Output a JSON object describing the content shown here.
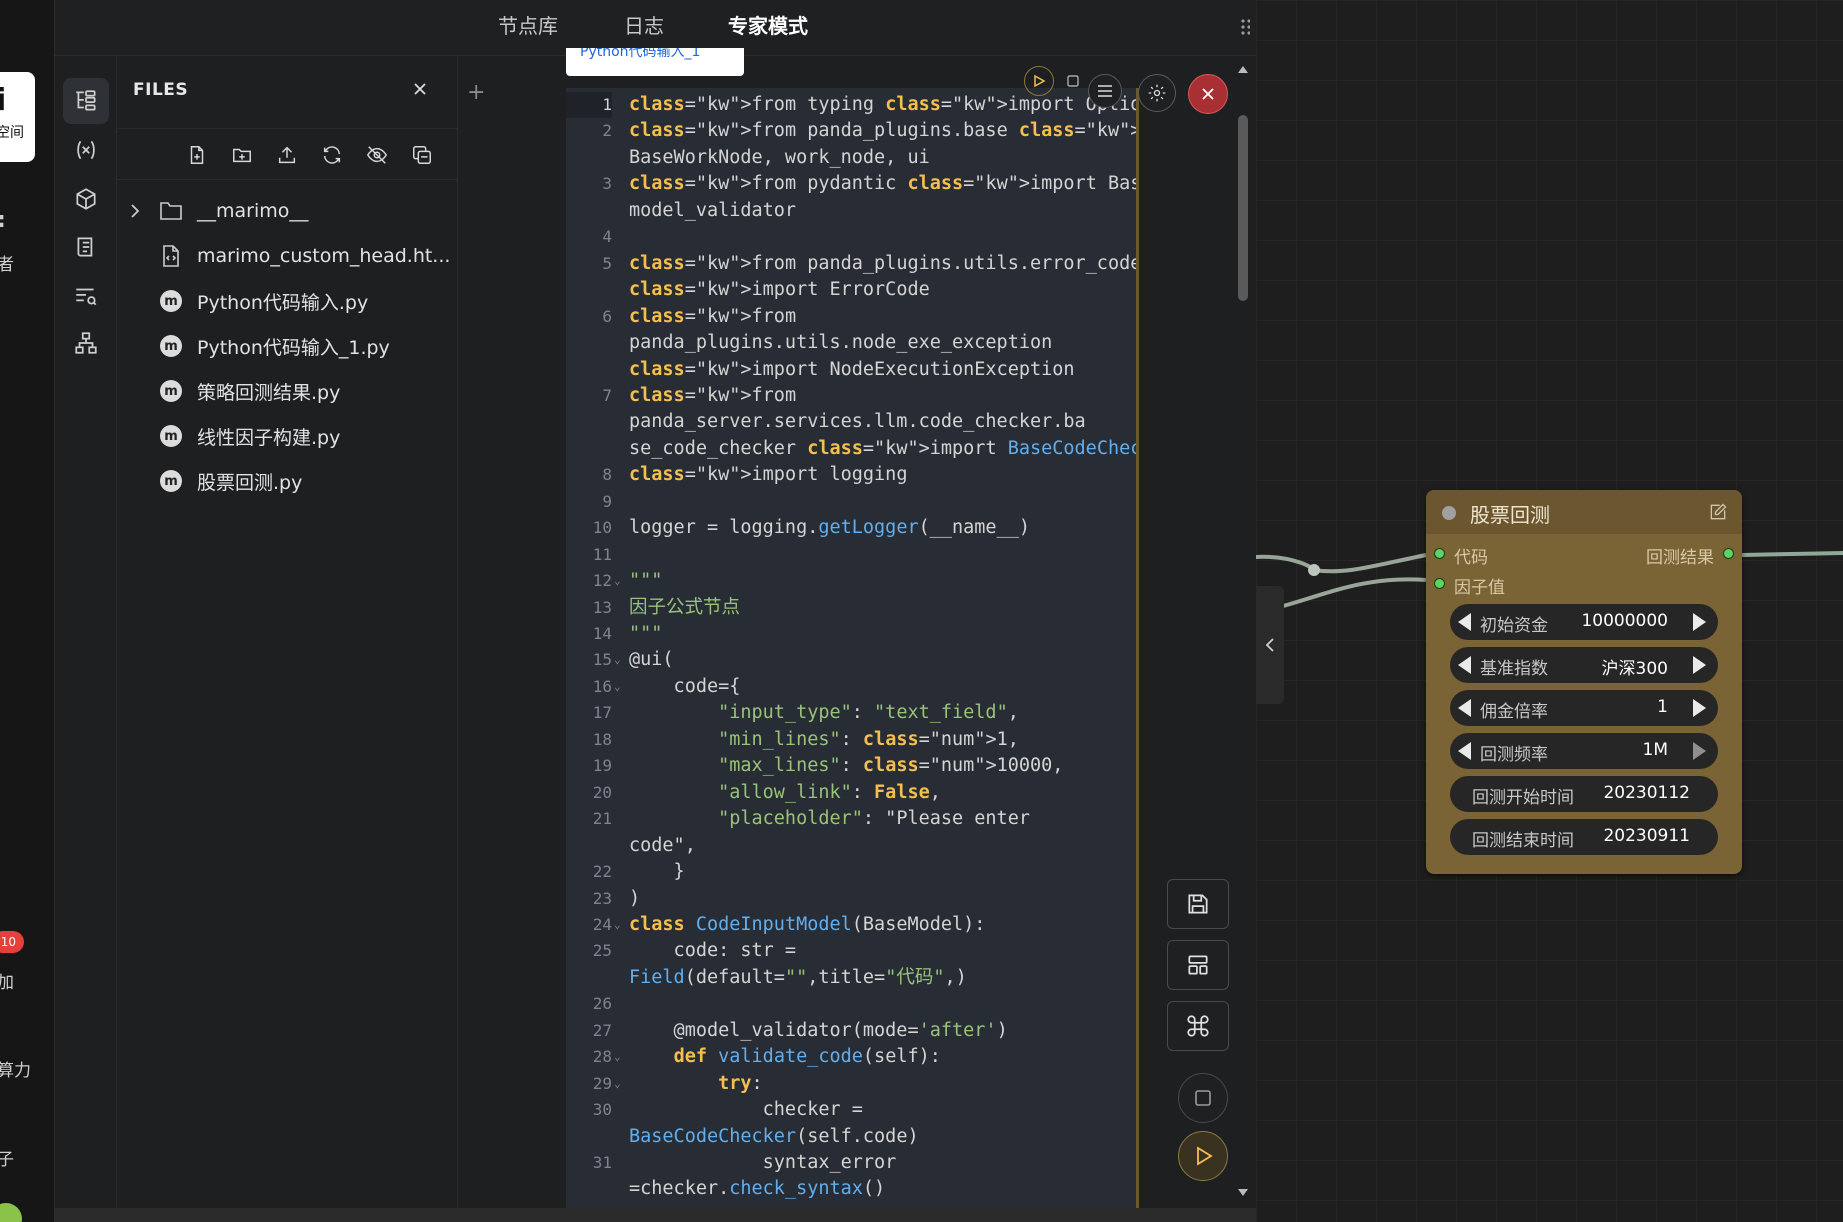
{
  "left_strip": {
    "card_big": "i",
    "card_small": "空间",
    "label_1": "者",
    "badge": "10",
    "label_2": "加",
    "label_3": "算力",
    "label_4": "子"
  },
  "tabs": [
    {
      "label": "节点库"
    },
    {
      "label": "日志"
    },
    {
      "label": "专家模式"
    }
  ],
  "files": {
    "title": "FILES",
    "items": [
      {
        "name": "__marimo__",
        "type": "folder"
      },
      {
        "name": "marimo_custom_head.ht...",
        "type": "file"
      },
      {
        "name": "Python代码输入.py",
        "type": "marimo"
      },
      {
        "name": "Python代码输入_1.py",
        "type": "marimo"
      },
      {
        "name": "策略回测结果.py",
        "type": "marimo"
      },
      {
        "name": "线性因子构建.py",
        "type": "marimo"
      },
      {
        "name": "股票回测.py",
        "type": "marimo"
      }
    ]
  },
  "editor": {
    "cell_tab": "Python代码输入_1",
    "add_label": "+"
  },
  "code_lines": [
    {
      "n": "1",
      "t": "from typing import Optional, Type, Union"
    },
    {
      "n": "2",
      "t": "from panda_plugins.base import"
    },
    {
      "n": "",
      "t": "BaseWorkNode, work_node, ui"
    },
    {
      "n": "3",
      "t": "from pydantic import BaseModel, Field,"
    },
    {
      "n": "",
      "t": "model_validator"
    },
    {
      "n": "4",
      "t": ""
    },
    {
      "n": "5",
      "t": "from panda_plugins.utils.error_code"
    },
    {
      "n": "",
      "t": "import ErrorCode"
    },
    {
      "n": "6",
      "t": "from"
    },
    {
      "n": "",
      "t": "panda_plugins.utils.node_exe_exception"
    },
    {
      "n": "",
      "t": "import NodeExecutionException"
    },
    {
      "n": "7",
      "t": "from"
    },
    {
      "n": "",
      "t": "panda_server.services.llm.code_checker.ba"
    },
    {
      "n": "",
      "t": "se_code_checker import BaseCodeChecker"
    },
    {
      "n": "8",
      "t": "import logging"
    },
    {
      "n": "9",
      "t": ""
    },
    {
      "n": "10",
      "t": "logger = logging.getLogger(__name__)"
    },
    {
      "n": "11",
      "t": ""
    },
    {
      "n": "12",
      "t": "\"\"\""
    },
    {
      "n": "13",
      "t": "因子公式节点"
    },
    {
      "n": "14",
      "t": "\"\"\""
    },
    {
      "n": "15",
      "t": "@ui("
    },
    {
      "n": "16",
      "t": "    code={"
    },
    {
      "n": "17",
      "t": "        \"input_type\": \"text_field\","
    },
    {
      "n": "18",
      "t": "        \"min_lines\": 1,"
    },
    {
      "n": "19",
      "t": "        \"max_lines\": 10000,"
    },
    {
      "n": "20",
      "t": "        \"allow_link\": False,"
    },
    {
      "n": "21",
      "t": "        \"placeholder\": \"Please enter"
    },
    {
      "n": "",
      "t": "code\","
    },
    {
      "n": "22",
      "t": "    }"
    },
    {
      "n": "23",
      "t": ")"
    },
    {
      "n": "24",
      "t": "class CodeInputModel(BaseModel):"
    },
    {
      "n": "25",
      "t": "    code: str ="
    },
    {
      "n": "",
      "t": "Field(default=\"\",title=\"代码\",)"
    },
    {
      "n": "26",
      "t": ""
    },
    {
      "n": "27",
      "t": "    @model_validator(mode='after')"
    },
    {
      "n": "28",
      "t": "    def validate_code(self):"
    },
    {
      "n": "29",
      "t": "        try:"
    },
    {
      "n": "30",
      "t": "            checker ="
    },
    {
      "n": "",
      "t": "BaseCodeChecker(self.code)"
    },
    {
      "n": "31",
      "t": "            syntax_error"
    },
    {
      "n": "",
      "t": "=checker.check_syntax()"
    }
  ],
  "node": {
    "title": "股票回测",
    "inputs": [
      {
        "label": "代码"
      },
      {
        "label": "因子值"
      }
    ],
    "outputs": [
      {
        "label": "回测结果"
      }
    ],
    "widgets": [
      {
        "label": "初始资金",
        "value": "10000000",
        "arrows": true
      },
      {
        "label": "基准指数",
        "value": "沪深300",
        "arrows": true
      },
      {
        "label": "佣金倍率",
        "value": "1",
        "arrows": true
      },
      {
        "label": "回测频率",
        "value": "1M",
        "arrows": true
      },
      {
        "label": "回测开始时间",
        "value": "20230112",
        "arrows": false
      },
      {
        "label": "回测结束时间",
        "value": "20230911",
        "arrows": false
      }
    ]
  },
  "colors": {
    "keyword": "#f4bf4f",
    "function": "#61afef",
    "string": "#98c379",
    "number": "#d19a66",
    "node_body": "#7a6334",
    "port": "#5ed35e",
    "close_button": "#b03535"
  }
}
